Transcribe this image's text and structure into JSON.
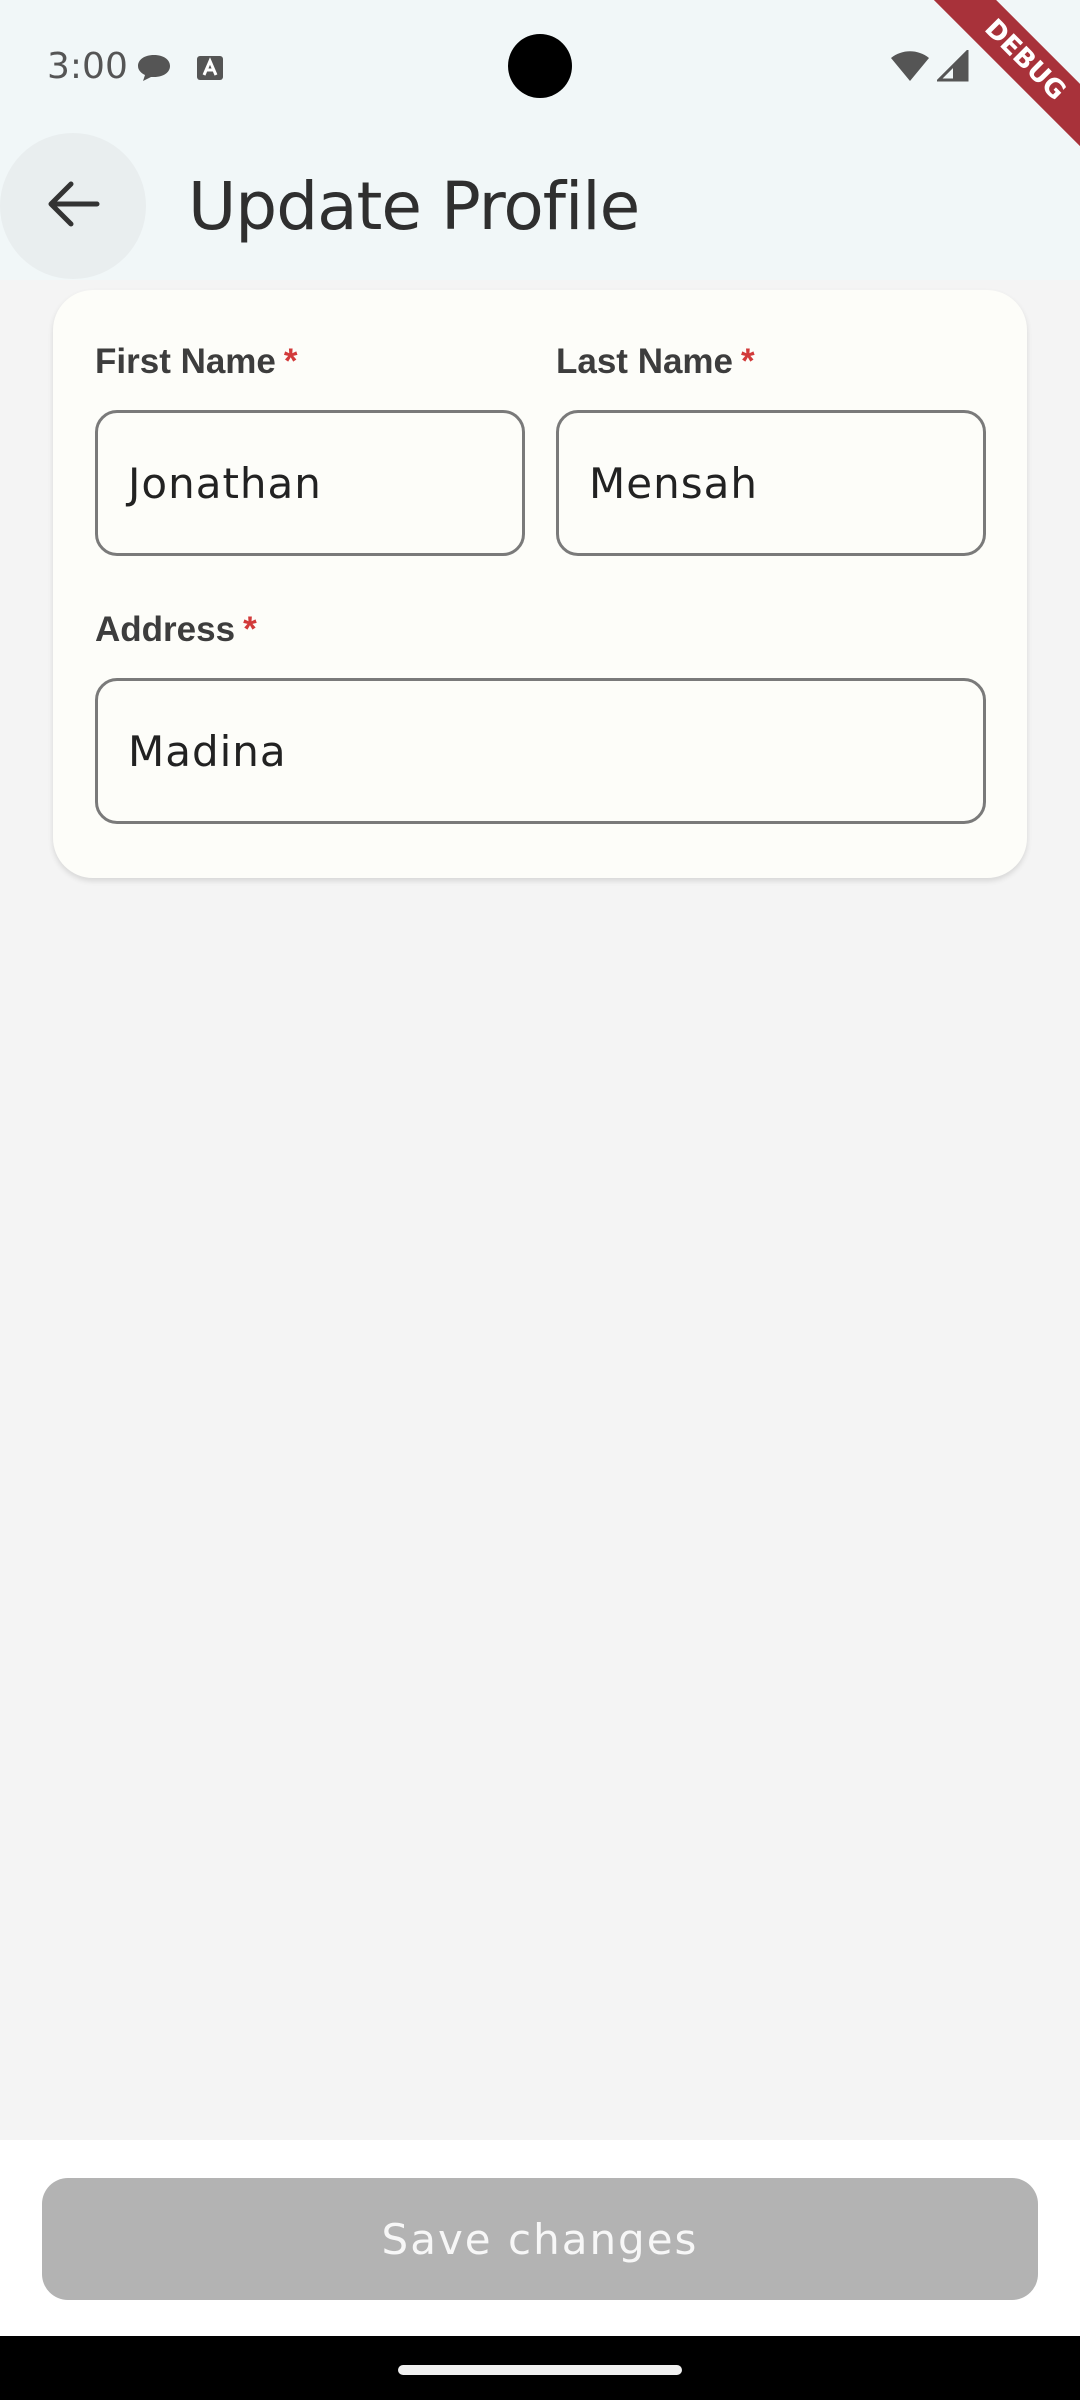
{
  "status_bar": {
    "time": "3:00",
    "icons": [
      "chat-bubble-icon",
      "keyboard-a-icon",
      "wifi-icon",
      "signal-icon"
    ]
  },
  "debug_banner": "DEBUG",
  "app_bar": {
    "back_icon": "arrow-left-icon",
    "title": "Update Profile"
  },
  "form": {
    "first_name": {
      "label": "First Name",
      "required": "*",
      "value": "Jonathan"
    },
    "last_name": {
      "label": "Last Name",
      "required": "*",
      "value": "Mensah"
    },
    "address": {
      "label": "Address",
      "required": "*",
      "value": "Madina"
    }
  },
  "actions": {
    "save_label": "Save changes",
    "save_enabled": false
  },
  "colors": {
    "required": "#d23a3a",
    "disabled_button": "#b3b3b3",
    "debug_ribbon": "#a8323a"
  }
}
